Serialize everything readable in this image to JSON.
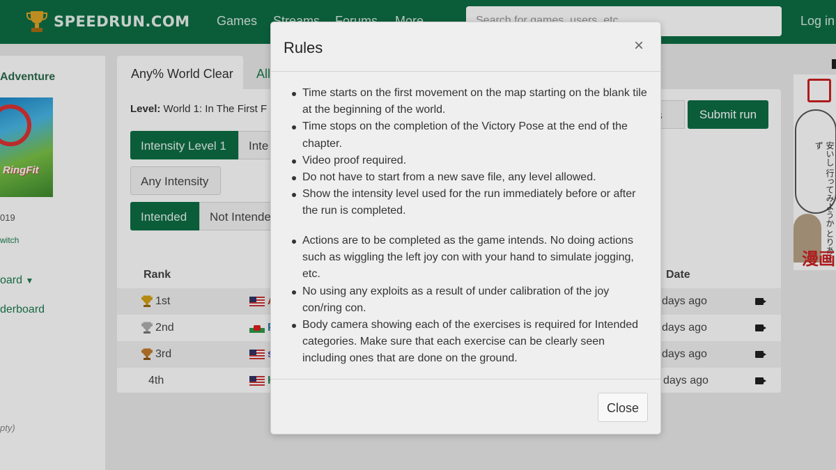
{
  "header": {
    "logo_text": "SPEEDRUN.COM",
    "nav": [
      "Games",
      "Streams",
      "Forums",
      "More"
    ],
    "search_placeholder": "Search for games, users, etc",
    "login": "Log in"
  },
  "sidebar": {
    "game_title": "Adventure",
    "cover_text": "RingFit",
    "year": "019",
    "platform": "witch",
    "board_link": "oard",
    "leaderboard_link": "derboard",
    "empty_note": "pty)"
  },
  "tabs": {
    "active": "Any% World Clear",
    "next": "All"
  },
  "level": {
    "label": "Level:",
    "value": "World 1: In The First F"
  },
  "filters": {
    "intensity": [
      "Intensity Level 1",
      "Inte",
      "Any Intensity"
    ],
    "intended": [
      "Intended",
      "Not Intende"
    ]
  },
  "actions": {
    "rules": "les",
    "submit": "Submit run"
  },
  "table": {
    "headers": {
      "rank": "Rank",
      "date": "Date"
    },
    "rows": [
      {
        "rank": "1st",
        "player": "A",
        "flag": "us",
        "date": "days ago",
        "player_color": "#c0392b"
      },
      {
        "rank": "2nd",
        "player": "Pe",
        "flag": "wales",
        "date": "days ago",
        "player_color": "#2a7ab0"
      },
      {
        "rank": "3rd",
        "player": "s",
        "flag": "us",
        "date": "days ago",
        "player_color": "#5b4bb5"
      },
      {
        "rank": "4th",
        "player": "Ka",
        "flag": "us",
        "date": "days ago",
        "player_color": "#2e8b57"
      }
    ],
    "trophy_colors": [
      "#d4a017",
      "#b0b0b0",
      "#c27c2c"
    ]
  },
  "ad": {
    "jp_text": "安いし 行ってみようか とりあえず",
    "manga": "漫画"
  },
  "modal": {
    "title": "Rules",
    "close_x": "×",
    "rules_group1": [
      "Time starts on the first movement on the map starting on the blank tile at the beginning of the world.",
      "Time stops on the completion of the Victory Pose at the end of the chapter.",
      "Video proof required.",
      "Do not have to start from a new save file, any level allowed.",
      "Show the intensity level used for the run immediately before or after the run is completed."
    ],
    "rules_group2": [
      "Actions are to be completed as the game intends. No doing actions such as wiggling the left joy con with your hand to simulate jogging, etc.",
      "No using any exploits as a result of under calibration of the joy con/ring con.",
      "Body camera showing each of the exercises is required for Intended categories. Make sure that each exercise can be clearly seen including ones that are done on the ground."
    ],
    "close_button": "Close"
  },
  "colors": {
    "brand": "#0e6e45",
    "modal_bg": "#efefef"
  }
}
